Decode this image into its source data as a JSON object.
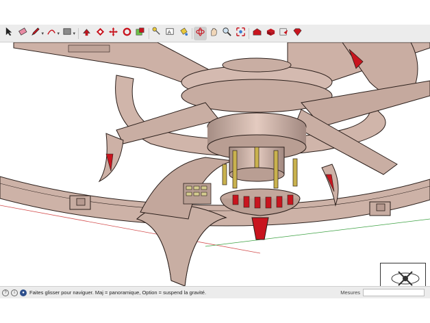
{
  "toolbar": {
    "tools": [
      {
        "name": "select-arrow-icon",
        "glyph": "arrow"
      },
      {
        "name": "eraser-icon",
        "glyph": "eraser"
      },
      {
        "name": "pencil-icon",
        "glyph": "pencil",
        "dropdown": true
      },
      {
        "name": "arc-icon",
        "glyph": "arc",
        "dropdown": true
      },
      {
        "name": "rectangle-icon",
        "glyph": "rect",
        "dropdown": true
      },
      {
        "name": "push-pull-icon",
        "glyph": "pushpull"
      },
      {
        "name": "offset-icon",
        "glyph": "offset"
      },
      {
        "name": "move-icon",
        "glyph": "move"
      },
      {
        "name": "rotate-icon",
        "glyph": "rotate"
      },
      {
        "name": "scale-icon",
        "glyph": "scale"
      },
      {
        "name": "tape-measure-icon",
        "glyph": "tape"
      },
      {
        "name": "text-icon",
        "glyph": "text"
      },
      {
        "name": "paint-bucket-icon",
        "glyph": "paint"
      },
      {
        "name": "orbit-icon",
        "glyph": "orbit",
        "active": true
      },
      {
        "name": "pan-icon",
        "glyph": "pan"
      },
      {
        "name": "zoom-icon",
        "glyph": "zoom"
      },
      {
        "name": "zoom-extents-icon",
        "glyph": "extents"
      },
      {
        "name": "warehouse-icon",
        "glyph": "warehouse"
      },
      {
        "name": "extension-warehouse-icon",
        "glyph": "extwh"
      },
      {
        "name": "send-to-layout-icon",
        "glyph": "layout"
      },
      {
        "name": "extension-manager-icon",
        "glyph": "gem"
      }
    ]
  },
  "status": {
    "text": "Faites glisser pour naviguer. Maj = panoramique, Option =  suspend la gravité.",
    "measures_label": "Mesures",
    "measures_value": ""
  },
  "colors": {
    "model_fill": "#d7bdb2",
    "model_stroke": "#2a1e1a",
    "accent_red": "#c8141e",
    "gold": "#c9b24e"
  }
}
